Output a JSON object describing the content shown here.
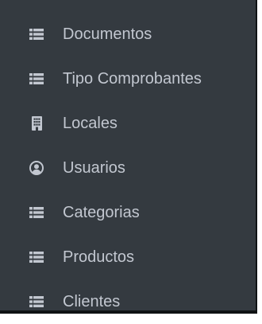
{
  "sidebar": {
    "items": [
      {
        "label": "Documentos",
        "icon": "list-icon"
      },
      {
        "label": "Tipo Comprobantes",
        "icon": "list-icon"
      },
      {
        "label": "Locales",
        "icon": "building-icon"
      },
      {
        "label": "Usuarios",
        "icon": "user-circle-icon"
      },
      {
        "label": "Categorias",
        "icon": "list-icon"
      },
      {
        "label": "Productos",
        "icon": "list-icon"
      },
      {
        "label": "Clientes",
        "icon": "list-icon"
      }
    ]
  },
  "colors": {
    "background": "#343a40",
    "text": "#c2c7d0",
    "icon": "#c2c7d0"
  }
}
